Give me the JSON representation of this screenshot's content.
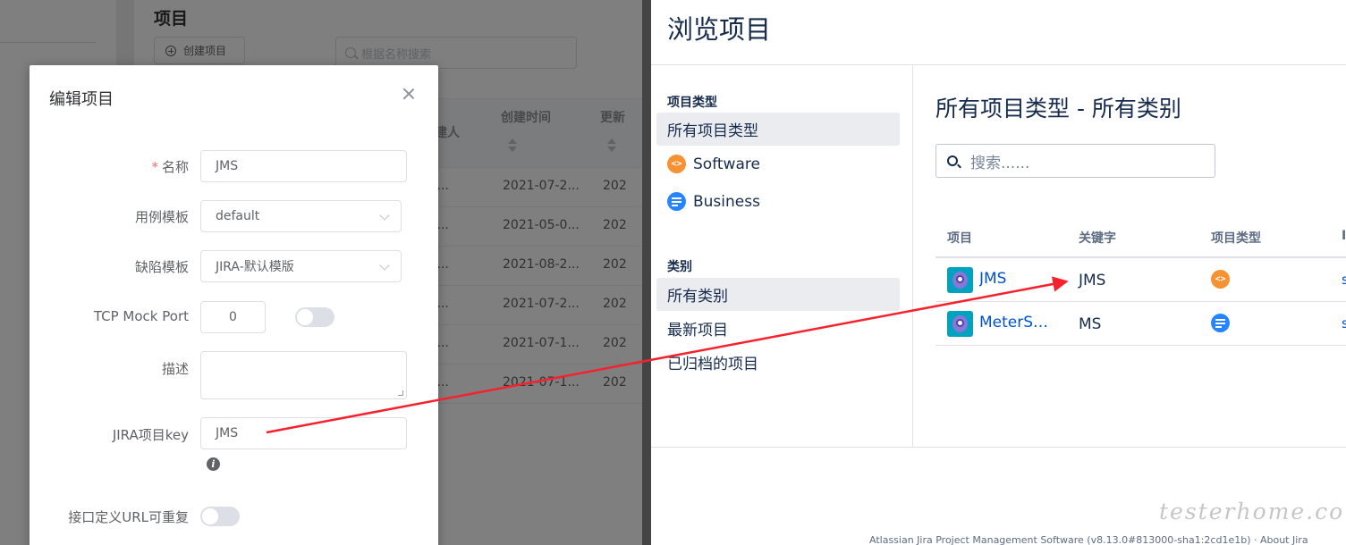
{
  "background": {
    "title": "项目",
    "create_button": "创建项目",
    "search_placeholder": "根据名称搜索",
    "columns": [
      "建人",
      "创建时间",
      "更新"
    ],
    "rows": [
      {
        "creator": "Admini...",
        "created": "2021-07-2...",
        "updated": "202"
      },
      {
        "creator": "Admini...",
        "created": "2021-05-0...",
        "updated": "202"
      },
      {
        "creator": "Admini...",
        "created": "2021-08-2...",
        "updated": "202"
      },
      {
        "creator": "Admini...",
        "created": "2021-07-2...",
        "updated": "202"
      },
      {
        "creator": "Admini...",
        "created": "2021-07-1...",
        "updated": "202"
      },
      {
        "creator": "Admini...",
        "created": "2021-07-1...",
        "updated": "202"
      }
    ]
  },
  "dialog": {
    "title": "编辑项目",
    "fields": {
      "name": {
        "label": "名称",
        "value": "JMS"
      },
      "case_template": {
        "label": "用例模板",
        "value": "default"
      },
      "issue_template": {
        "label": "缺陷模板",
        "value": "JIRA-默认模版"
      },
      "tcp_mock_port": {
        "label": "TCP Mock Port",
        "value": "0"
      },
      "description": {
        "label": "描述",
        "value": ""
      },
      "jira_key": {
        "label": "JIRA项目key",
        "value": "JMS"
      },
      "url_repeatable": {
        "label": "接口定义URL可重复"
      }
    }
  },
  "jira": {
    "title": "浏览项目",
    "sidebar": {
      "section_types": "项目类型",
      "types": [
        {
          "label": "所有项目类型",
          "icon": null
        },
        {
          "label": "Software",
          "icon": "software-icon"
        },
        {
          "label": "Business",
          "icon": "business-icon"
        }
      ],
      "section_categories": "类别",
      "categories": [
        {
          "label": "所有类别"
        },
        {
          "label": "最新项目"
        },
        {
          "label": "已归档的项目"
        }
      ]
    },
    "heading": "所有项目类型 - 所有类别",
    "search_placeholder": "搜索......",
    "table": {
      "columns": [
        "项目",
        "关键字",
        "项目类型",
        "I"
      ],
      "rows": [
        {
          "name": "JMS",
          "key": "JMS",
          "type_icon": "software-icon",
          "lead": "s"
        },
        {
          "name": "MeterSp...",
          "key": "MS",
          "type_icon": "business-icon",
          "lead": "s"
        }
      ]
    },
    "footer": "Atlassian Jira Project Management Software (v8.13.0#813000-sha1:2cd1e1b) · About Jira"
  },
  "watermark": "testerhome.com",
  "colors": {
    "accent_red": "#f5222d",
    "jira_link": "#0052cc",
    "software": "#f79232",
    "business": "#2684ff"
  }
}
